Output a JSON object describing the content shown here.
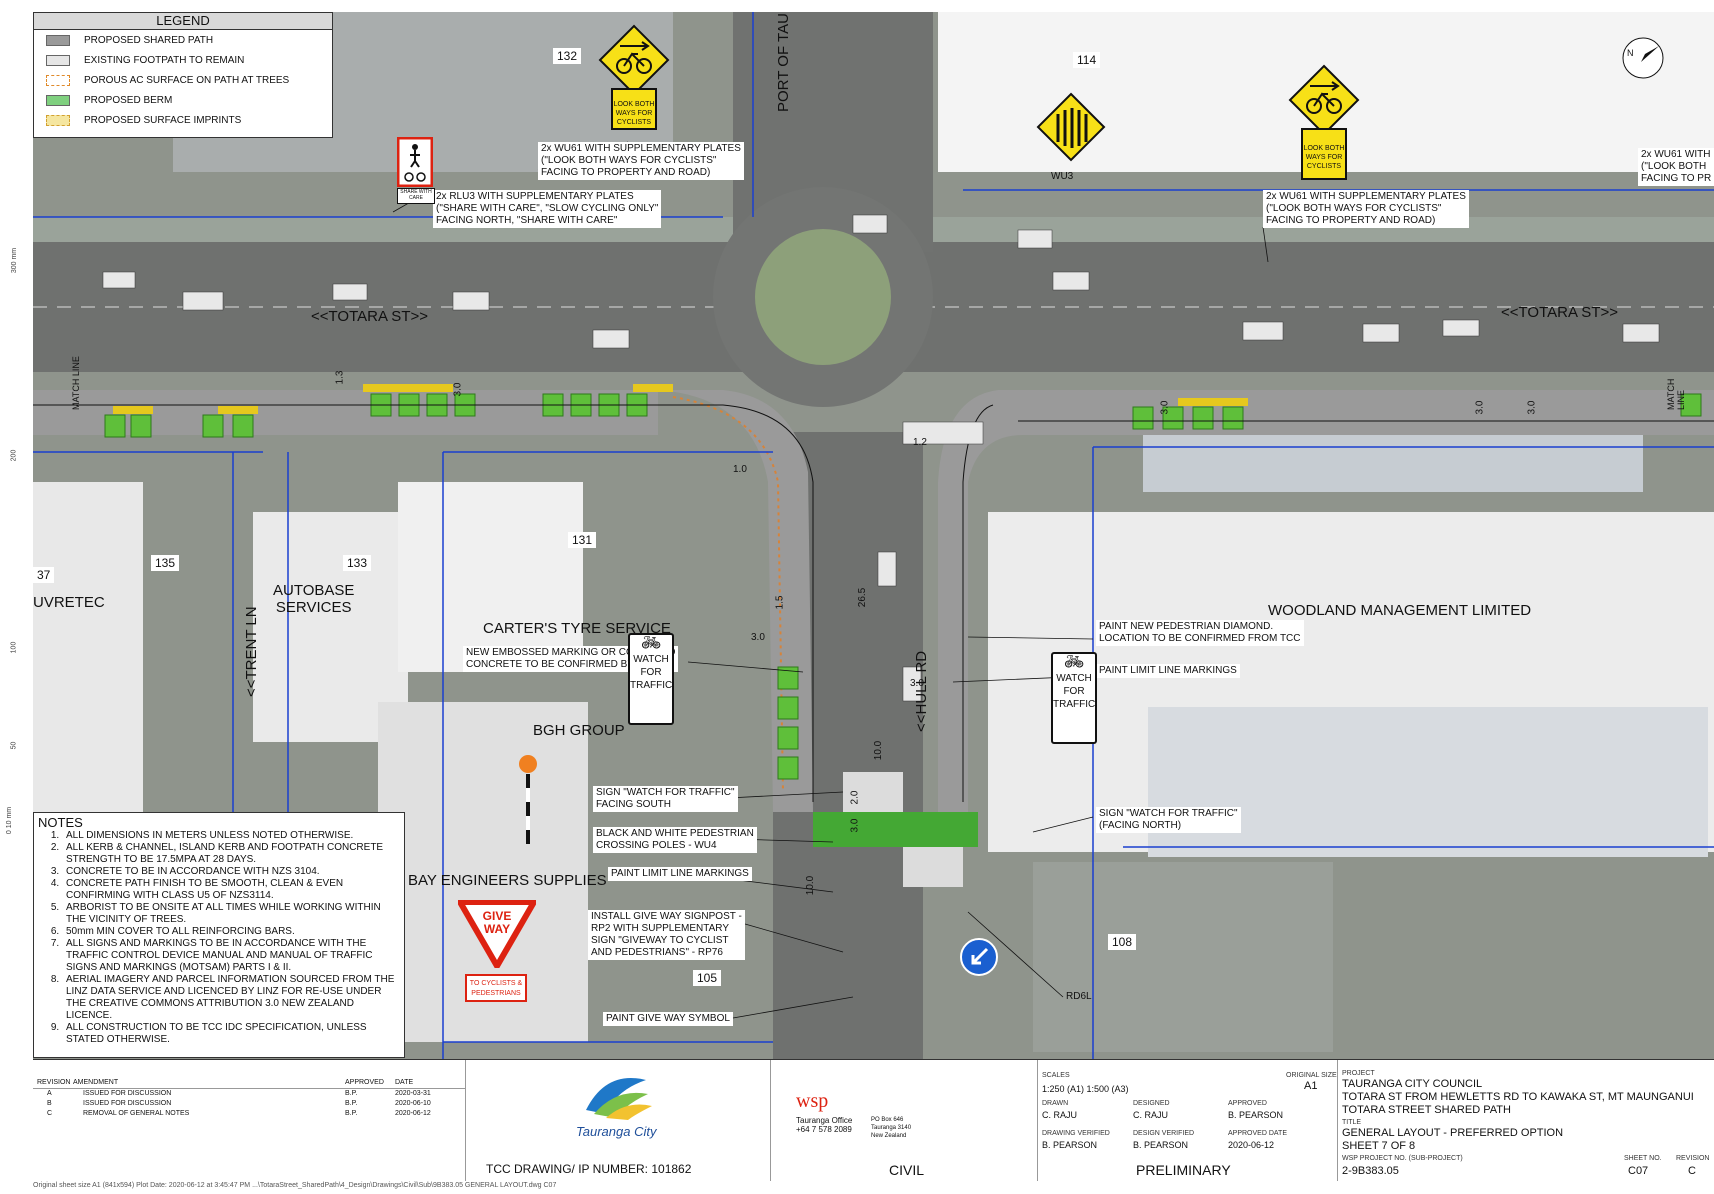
{
  "legend": {
    "title": "LEGEND",
    "items": [
      {
        "label": "PROPOSED SHARED PATH",
        "color": "#9a9a9a"
      },
      {
        "label": "EXISTING FOOTPATH TO REMAIN",
        "color": "#e6e6e6"
      },
      {
        "label": "POROUS AC SURFACE ON PATH AT TREES",
        "color": "#f0c890"
      },
      {
        "label": "PROPOSED BERM",
        "color": "#7fd07f"
      },
      {
        "label": "PROPOSED SURFACE IMPRINTS",
        "color": "#f5e6a0"
      }
    ]
  },
  "streets": {
    "totara_west": "<<TOTARA ST>>",
    "totara_east": "<<TOTARA ST>>",
    "port": "PORT OF TAURANGA>>",
    "hull": "<<HULL RD",
    "trent": "<<TRENT LN",
    "match_line": "MATCH LINE"
  },
  "properties": {
    "p132": "132",
    "p114": "114",
    "p135": "135",
    "p133": "133",
    "p131": "131",
    "p37": "37",
    "p108": "108",
    "p105": "105"
  },
  "businesses": {
    "autobase": "AUTOBASE\nSERVICES",
    "carters": "CARTER'S TYRE SERVICE",
    "bgh": "BGH GROUP",
    "bay": "BAY ENGINEERS SUPPLIES",
    "woodland": "WOODLAND MANAGEMENT LIMITED",
    "uvretec": "UVRETEC"
  },
  "callouts": {
    "wu61_west": "2x WU61 WITH SUPPLEMENTARY PLATES\n(\"LOOK BOTH WAYS FOR CYCLISTS\"\nFACING TO PROPERTY AND ROAD)",
    "rlu3": "2x RLU3 WITH SUPPLEMENTARY PLATES\n(\"SHARE WITH CARE\", \"SLOW CYCLING ONLY\"\nFACING NORTH, \"SHARE WITH CARE\"",
    "wu61_east": "2x WU61 WITH SUPPLEMENTARY PLATES\n(\"LOOK BOTH WAYS FOR CYCLISTS\"\nFACING TO PROPERTY AND ROAD)",
    "wu61_far": "2x WU61 WITH\n(\"LOOK BOTH\nFACING TO PR",
    "embossed": "NEW EMBOSSED MARKING OR COLOURED\nCONCRETE TO BE CONFIRMED BY TCC",
    "diamond": "PAINT NEW PEDESTRIAN DIAMOND.\nLOCATION TO BE CONFIRMED FROM TCC",
    "limit_east": "PAINT LIMIT LINE MARKINGS",
    "sign_south": "SIGN \"WATCH FOR TRAFFIC\"\nFACING SOUTH",
    "poles": "BLACK AND WHITE PEDESTRIAN\nCROSSING POLES - WU4",
    "sign_north": "SIGN \"WATCH FOR TRAFFIC\"\n(FACING NORTH)",
    "limit_west": "PAINT LIMIT LINE MARKINGS",
    "give_way_post": "INSTALL GIVE WAY SIGNPOST -\nRP2 WITH SUPPLEMENTARY\nSIGN \"GIVEWAY TO CYCLIST\nAND PEDESTRIANS\" - RP76",
    "give_way_symbol": "PAINT GIVE WAY SYMBOL",
    "wu3": "WU3",
    "rd6l": "RD6L"
  },
  "signs": {
    "look_both": "LOOK BOTH\nWAYS FOR\nCYCLISTS",
    "share_care": "SHARE WITH\nCARE",
    "watch_traffic": "WATCH\nFOR\nTRAFFIC",
    "give_way": "GIVE\nWAY",
    "to_cyclists": "TO CYCLISTS &\nPEDESTRIANS"
  },
  "dimensions": [
    "3.0",
    "3.0",
    "3.0",
    "1.3",
    "1.0",
    "1.2",
    "1.5",
    "3.0",
    "26.5",
    "3.0",
    "10.0",
    "2.0",
    "3.0",
    "10.0",
    "3.0"
  ],
  "ruler_labels": [
    "300 mm",
    "200",
    "100",
    "50",
    "0  10 mm"
  ],
  "notes": {
    "title": "NOTES",
    "items": [
      "ALL DIMENSIONS IN METERS UNLESS NOTED OTHERWISE.",
      "ALL KERB & CHANNEL, ISLAND KERB AND FOOTPATH CONCRETE STRENGTH TO BE 17.5MPA AT 28 DAYS.",
      "CONCRETE TO BE IN ACCORDANCE WITH NZS 3104.",
      "CONCRETE PATH FINISH TO BE SMOOTH, CLEAN & EVEN CONFIRMING WITH CLASS U5 OF NZS3114.",
      "ARBORIST TO BE ONSITE AT ALL TIMES WHILE WORKING WITHIN THE VICINITY OF TREES.",
      "50mm MIN COVER TO ALL REINFORCING BARS.",
      "ALL SIGNS AND MARKINGS TO BE IN ACCORDANCE WITH THE TRAFFIC CONTROL DEVICE MANUAL AND  MANUAL OF TRAFFIC SIGNS AND MARKINGS (MOTSAM) PARTS I & II.",
      "AERIAL IMAGERY AND PARCEL INFORMATION SOURCED FROM THE LINZ DATA SERVICE AND LICENCED BY LINZ FOR RE-USE UNDER THE CREATIVE COMMONS ATTRIBUTION 3.0 NEW ZEALAND LICENCE.",
      "ALL CONSTRUCTION TO BE TCC IDC SPECIFICATION, UNLESS STATED OTHERWISE."
    ]
  },
  "title_block": {
    "rev_headers": [
      "REVISION",
      "AMENDMENT",
      "APPROVED",
      "DATE"
    ],
    "revisions": [
      {
        "rev": "A",
        "amendment": "ISSUED FOR DISCUSSION",
        "approved": "B.P.",
        "date": "2020-03-31"
      },
      {
        "rev": "B",
        "amendment": "ISSUED FOR DISCUSSION",
        "approved": "B.P.",
        "date": "2020-06-10"
      },
      {
        "rev": "C",
        "amendment": "REMOVAL OF GENERAL NOTES",
        "approved": "B.P.",
        "date": "2020-06-12"
      }
    ],
    "council_logo_text": "Tauranga City",
    "tcc_drawing": "TCC DRAWING/ IP NUMBER: 101862",
    "wsp_logo": "wsp",
    "wsp_office": "Tauranga Office\n+64 7 578 2089",
    "wsp_address": "PO Box 646\nTauranga 3140\nNew Zealand",
    "discipline": "CIVIL",
    "scales_label": "SCALES",
    "scales": "1:250 (A1) 1:500 (A3)",
    "orig_size_label": "ORIGINAL SIZE",
    "orig_size": "A1",
    "drawn_label": "DRAWN",
    "drawn": "C. RAJU",
    "designed_label": "DESIGNED",
    "designed": "C. RAJU",
    "approved_label": "APPROVED",
    "approved": "B. PEARSON",
    "dv_label": "DRAWING VERIFIED",
    "dv": "B. PEARSON",
    "desv_label": "DESIGN VERIFIED",
    "desv": "B. PEARSON",
    "appdate_label": "APPROVED DATE",
    "appdate": "2020-06-12",
    "status": "PRELIMINARY",
    "project_label": "PROJECT",
    "project1": "TAURANGA CITY COUNCIL",
    "project2": "TOTARA ST FROM HEWLETTS RD TO KAWAKA ST, MT MAUNGANUI",
    "project3": "TOTARA STREET SHARED PATH",
    "title_label": "TITLE",
    "title1": "GENERAL LAYOUT - PREFERRED OPTION",
    "title2": "SHEET 7 OF 8",
    "projno_label": "WSP PROJECT NO. (SUB-PROJECT)",
    "projno": "2-9B383.05",
    "sheetno_label": "SHEET NO.",
    "sheetno": "C07",
    "rev_label": "REVISION",
    "rev": "C"
  },
  "footer": "Original sheet size A1 (841x594)   Plot Date: 2020-06-12 at 3:45:47 PM        ...\\TotaraStreet_SharedPath\\4_Design\\Drawings\\Civil\\Sub\\9B383.05 GENERAL LAYOUT.dwg  C07"
}
